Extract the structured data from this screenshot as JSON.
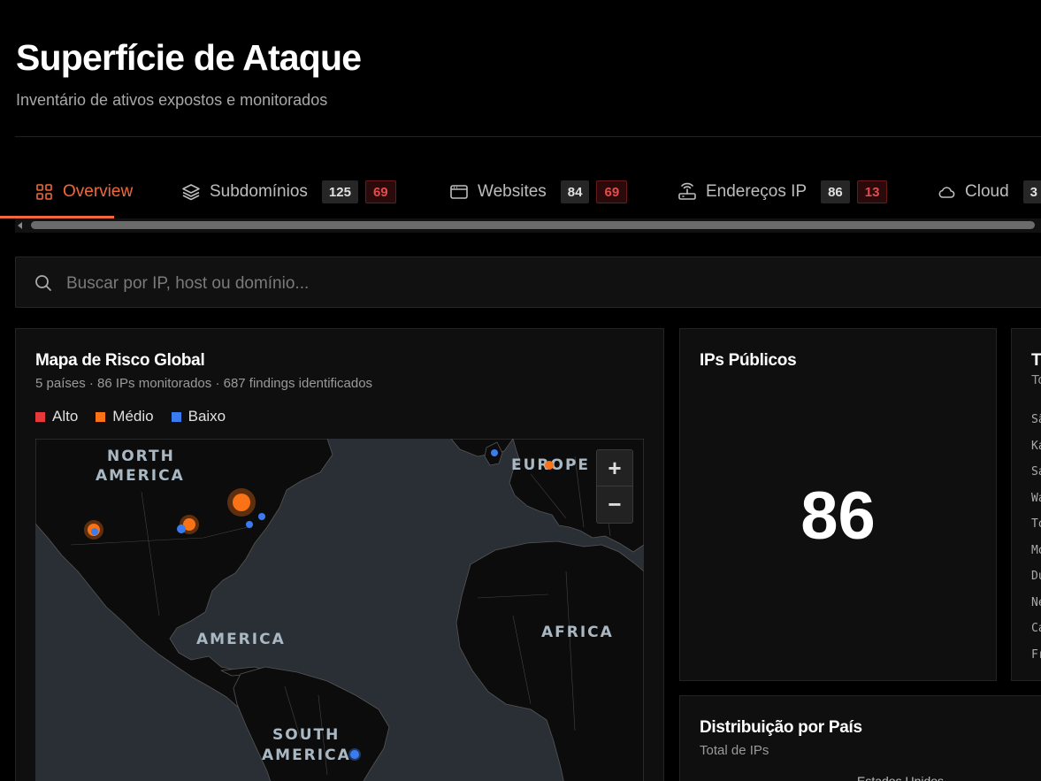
{
  "header": {
    "title": "Superfície de Ataque",
    "subtitle": "Inventário de ativos expostos e monitorados"
  },
  "tabs": [
    {
      "label": "Overview",
      "icon": "grid-icon",
      "active": true
    },
    {
      "label": "Subdomínios",
      "icon": "layers-icon",
      "count": "125",
      "alert": "69"
    },
    {
      "label": "Websites",
      "icon": "browser-window-icon",
      "count": "84",
      "alert": "69"
    },
    {
      "label": "Endereços IP",
      "icon": "router-icon",
      "count": "86",
      "alert": "13"
    },
    {
      "label": "Cloud",
      "icon": "cloud-icon",
      "count": "3"
    }
  ],
  "search": {
    "placeholder": "Buscar por IP, host ou domínio..."
  },
  "map_card": {
    "title": "Mapa de Risco Global",
    "subtitle": "5 países · 86 IPs monitorados · 687 findings identificados",
    "legend": [
      {
        "label": "Alto",
        "color": "#e5393c"
      },
      {
        "label": "Médio",
        "color": "#f97316"
      },
      {
        "label": "Baixo",
        "color": "#3b7bf0"
      }
    ],
    "map_labels": {
      "north_america": [
        "NORTH",
        "AMERICA"
      ],
      "europe": "EUROPE",
      "america": "AMERICA",
      "africa": "AFRICA",
      "south_america": [
        "SOUTH",
        "AMERICA"
      ]
    },
    "zoom_in": "+",
    "zoom_out": "−"
  },
  "ips_card": {
    "title": "IPs Públicos",
    "value": "86"
  },
  "top_card": {
    "title": "T",
    "subtitle": "To",
    "items": [
      "Sã",
      "Ka",
      "Sa",
      "Wa",
      "To",
      "Mo",
      "Du",
      "Ne",
      "Ca",
      "Fr"
    ]
  },
  "dist_card": {
    "title": "Distribuição por País",
    "subtitle": "Total de IPs",
    "partial_label": "Estados Unidos"
  },
  "colors": {
    "accent": "#f2683a",
    "alert_red": "#e84b4b",
    "background": "#000000",
    "card": "#0f0f0f"
  }
}
